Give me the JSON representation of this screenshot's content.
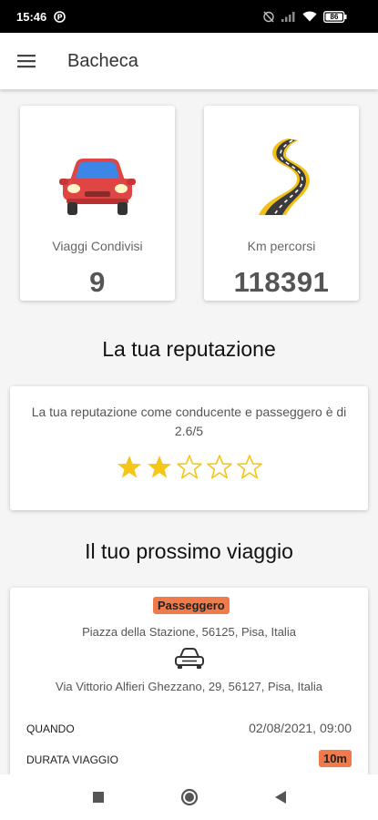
{
  "status_bar": {
    "time": "15:46",
    "battery": "86"
  },
  "app_bar": {
    "title": "Bacheca",
    "menu_icon": "hamburger-menu-icon"
  },
  "stats": [
    {
      "label": "Viaggi Condivisi",
      "value": "9",
      "icon": "car-illustration"
    },
    {
      "label": "Km percorsi",
      "value": "118391",
      "icon": "road-illustration"
    }
  ],
  "reputation": {
    "section_title": "La tua reputazione",
    "text": "La tua reputazione come conducente e passeggero è di 2.6/5",
    "rating": 2.6,
    "max_rating": 5,
    "star_color": "#f5c518"
  },
  "next_trip": {
    "section_title": "Il tuo prossimo viaggio",
    "role_badge": "Passeggero",
    "from": "Piazza della Stazione, 56125, Pisa, Italia",
    "to": "Via Vittorio Alfieri Ghezzano, 29, 56127, Pisa, Italia",
    "when_label": "QUANDO",
    "when_value": "02/08/2021, 09:00",
    "duration_label": "DURATA VIAGGIO",
    "duration_value": "10m",
    "badge_color": "#f07a4a"
  },
  "nav_bar": {
    "icons": [
      "recents-square-icon",
      "home-circle-icon",
      "back-triangle-icon"
    ]
  }
}
